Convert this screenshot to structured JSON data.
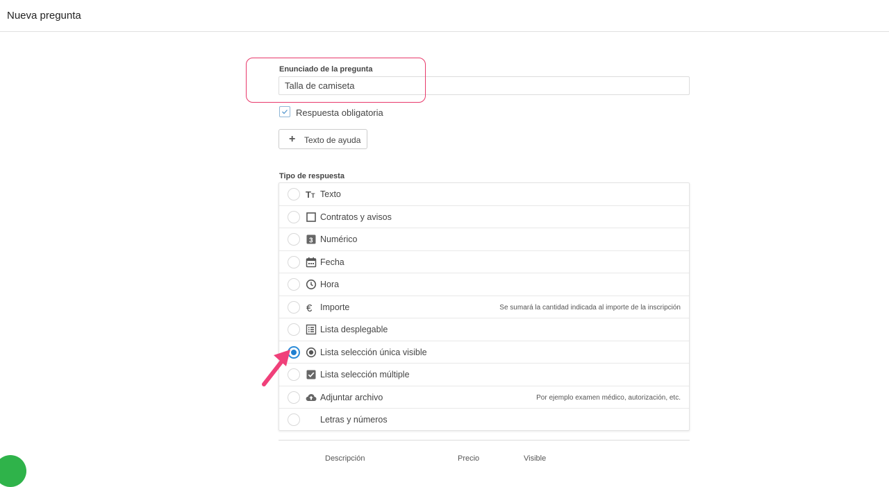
{
  "header": {
    "title": "Nueva pregunta"
  },
  "question": {
    "label": "Enunciado de la pregunta",
    "value": "Talla de camiseta"
  },
  "required": {
    "label": "Respuesta obligatoria",
    "checked": true
  },
  "help_button": {
    "label": "Texto de ayuda",
    "icon": "plus-icon"
  },
  "answer_type": {
    "label": "Tipo de respuesta",
    "options": [
      {
        "label": "Texto",
        "icon": "text-format-icon",
        "note": ""
      },
      {
        "label": "Contratos y avisos",
        "icon": "checkbox-outline-icon",
        "note": ""
      },
      {
        "label": "Numérico",
        "icon": "number-icon",
        "note": ""
      },
      {
        "label": "Fecha",
        "icon": "calendar-icon",
        "note": ""
      },
      {
        "label": "Hora",
        "icon": "clock-icon",
        "note": ""
      },
      {
        "label": "Importe",
        "icon": "euro-icon",
        "note": "Se sumará la cantidad indicada al importe de la inscripción"
      },
      {
        "label": "Lista desplegable",
        "icon": "list-icon",
        "note": ""
      },
      {
        "label": "Lista selección única visible",
        "icon": "radio-icon",
        "note": ""
      },
      {
        "label": "Lista selección múltiple",
        "icon": "checkbox-checked-icon",
        "note": ""
      },
      {
        "label": "Adjuntar archivo",
        "icon": "cloud-upload-icon",
        "note": "Por ejemplo examen médico, autorización, etc."
      },
      {
        "label": "Letras y números",
        "icon": "",
        "note": ""
      }
    ],
    "selected_index": 7
  },
  "footer_columns": [
    "Descripción",
    "Precio",
    "Visible"
  ],
  "colors": {
    "highlight": "#e8386a",
    "arrow": "#f0407a",
    "radio_selected": "#1f7fd0",
    "fab": "#2fb34a"
  }
}
